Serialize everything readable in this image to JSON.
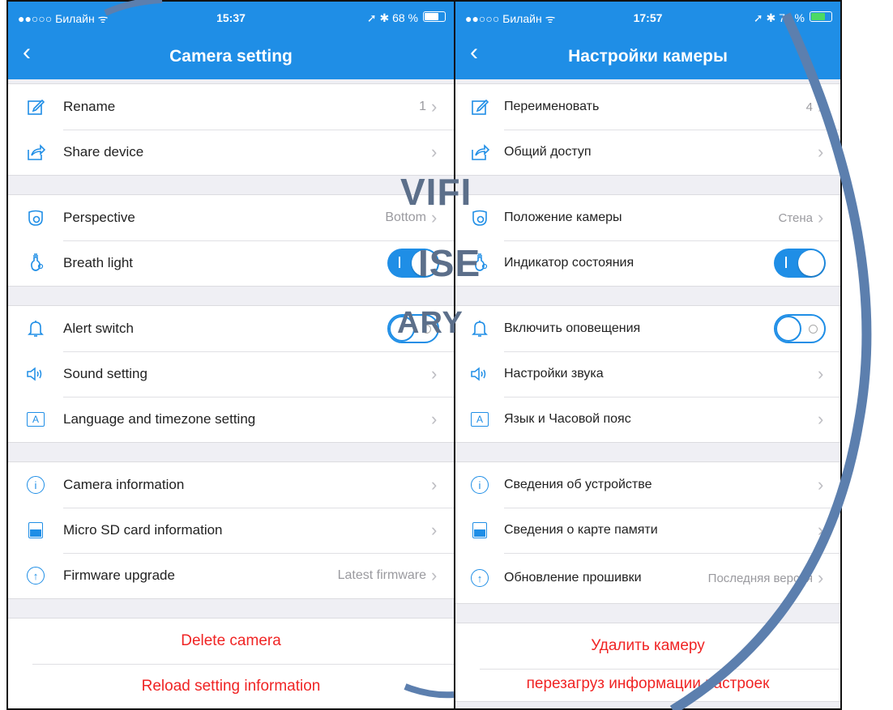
{
  "left": {
    "status": {
      "carrier": "●●○○○ Билайн ᯤ",
      "time": "15:37",
      "right": "➚ ✱ 68 %",
      "battery_pct": 68
    },
    "nav": {
      "back": "‹",
      "title": "Camera setting"
    },
    "rows": {
      "rename": {
        "label": "Rename",
        "value": "1"
      },
      "share": {
        "label": "Share device"
      },
      "perspective": {
        "label": "Perspective",
        "value": "Bottom"
      },
      "breath": {
        "label": "Breath light",
        "on": true
      },
      "alert": {
        "label": "Alert switch",
        "on": false
      },
      "sound": {
        "label": "Sound setting"
      },
      "language": {
        "label": "Language and timezone setting"
      },
      "caminfo": {
        "label": "Camera information"
      },
      "sdinfo": {
        "label": "Micro SD card information"
      },
      "firmware": {
        "label": "Firmware upgrade",
        "value": "Latest firmware"
      }
    },
    "actions": {
      "delete": "Delete camera",
      "reload": "Reload setting information"
    }
  },
  "right": {
    "status": {
      "carrier": "●●○○○ Билайн ᯤ",
      "time": "17:57",
      "right": "➚ ✱ 70 %",
      "battery_pct": 70
    },
    "nav": {
      "back": "‹",
      "title": "Настройки камеры"
    },
    "rows": {
      "rename": {
        "label": "Переименовать",
        "value": "4"
      },
      "share": {
        "label": "Общий доступ"
      },
      "perspective": {
        "label": "Положение камеры",
        "value": "Стена"
      },
      "breath": {
        "label": "Индикатор состояния",
        "on": true
      },
      "alert": {
        "label": "Включить оповещения",
        "on": false
      },
      "sound": {
        "label": "Настройки звука"
      },
      "language": {
        "label": "Язык и Часовой пояс"
      },
      "caminfo": {
        "label": "Сведения об устройстве"
      },
      "sdinfo": {
        "label": "Сведения о карте памяти"
      },
      "firmware": {
        "label": "Обновление прошивки",
        "value": "Последняя версия"
      }
    },
    "actions": {
      "delete": "Удалить камеру",
      "reload": "перезагруз информации настроек"
    }
  },
  "watermark": {
    "line1": "VIFI",
    "line2": "ISE",
    "line3": "ARY"
  },
  "chevron": "›",
  "icons": [
    "edit-icon",
    "share-icon",
    "camera-perspective-icon",
    "breath-light-icon",
    "bell-icon",
    "speaker-icon",
    "language-icon",
    "info-icon",
    "sd-card-icon",
    "upgrade-icon"
  ],
  "colors": {
    "accent": "#1f8ee6",
    "danger": "#f02424",
    "background": "#efeff4"
  }
}
